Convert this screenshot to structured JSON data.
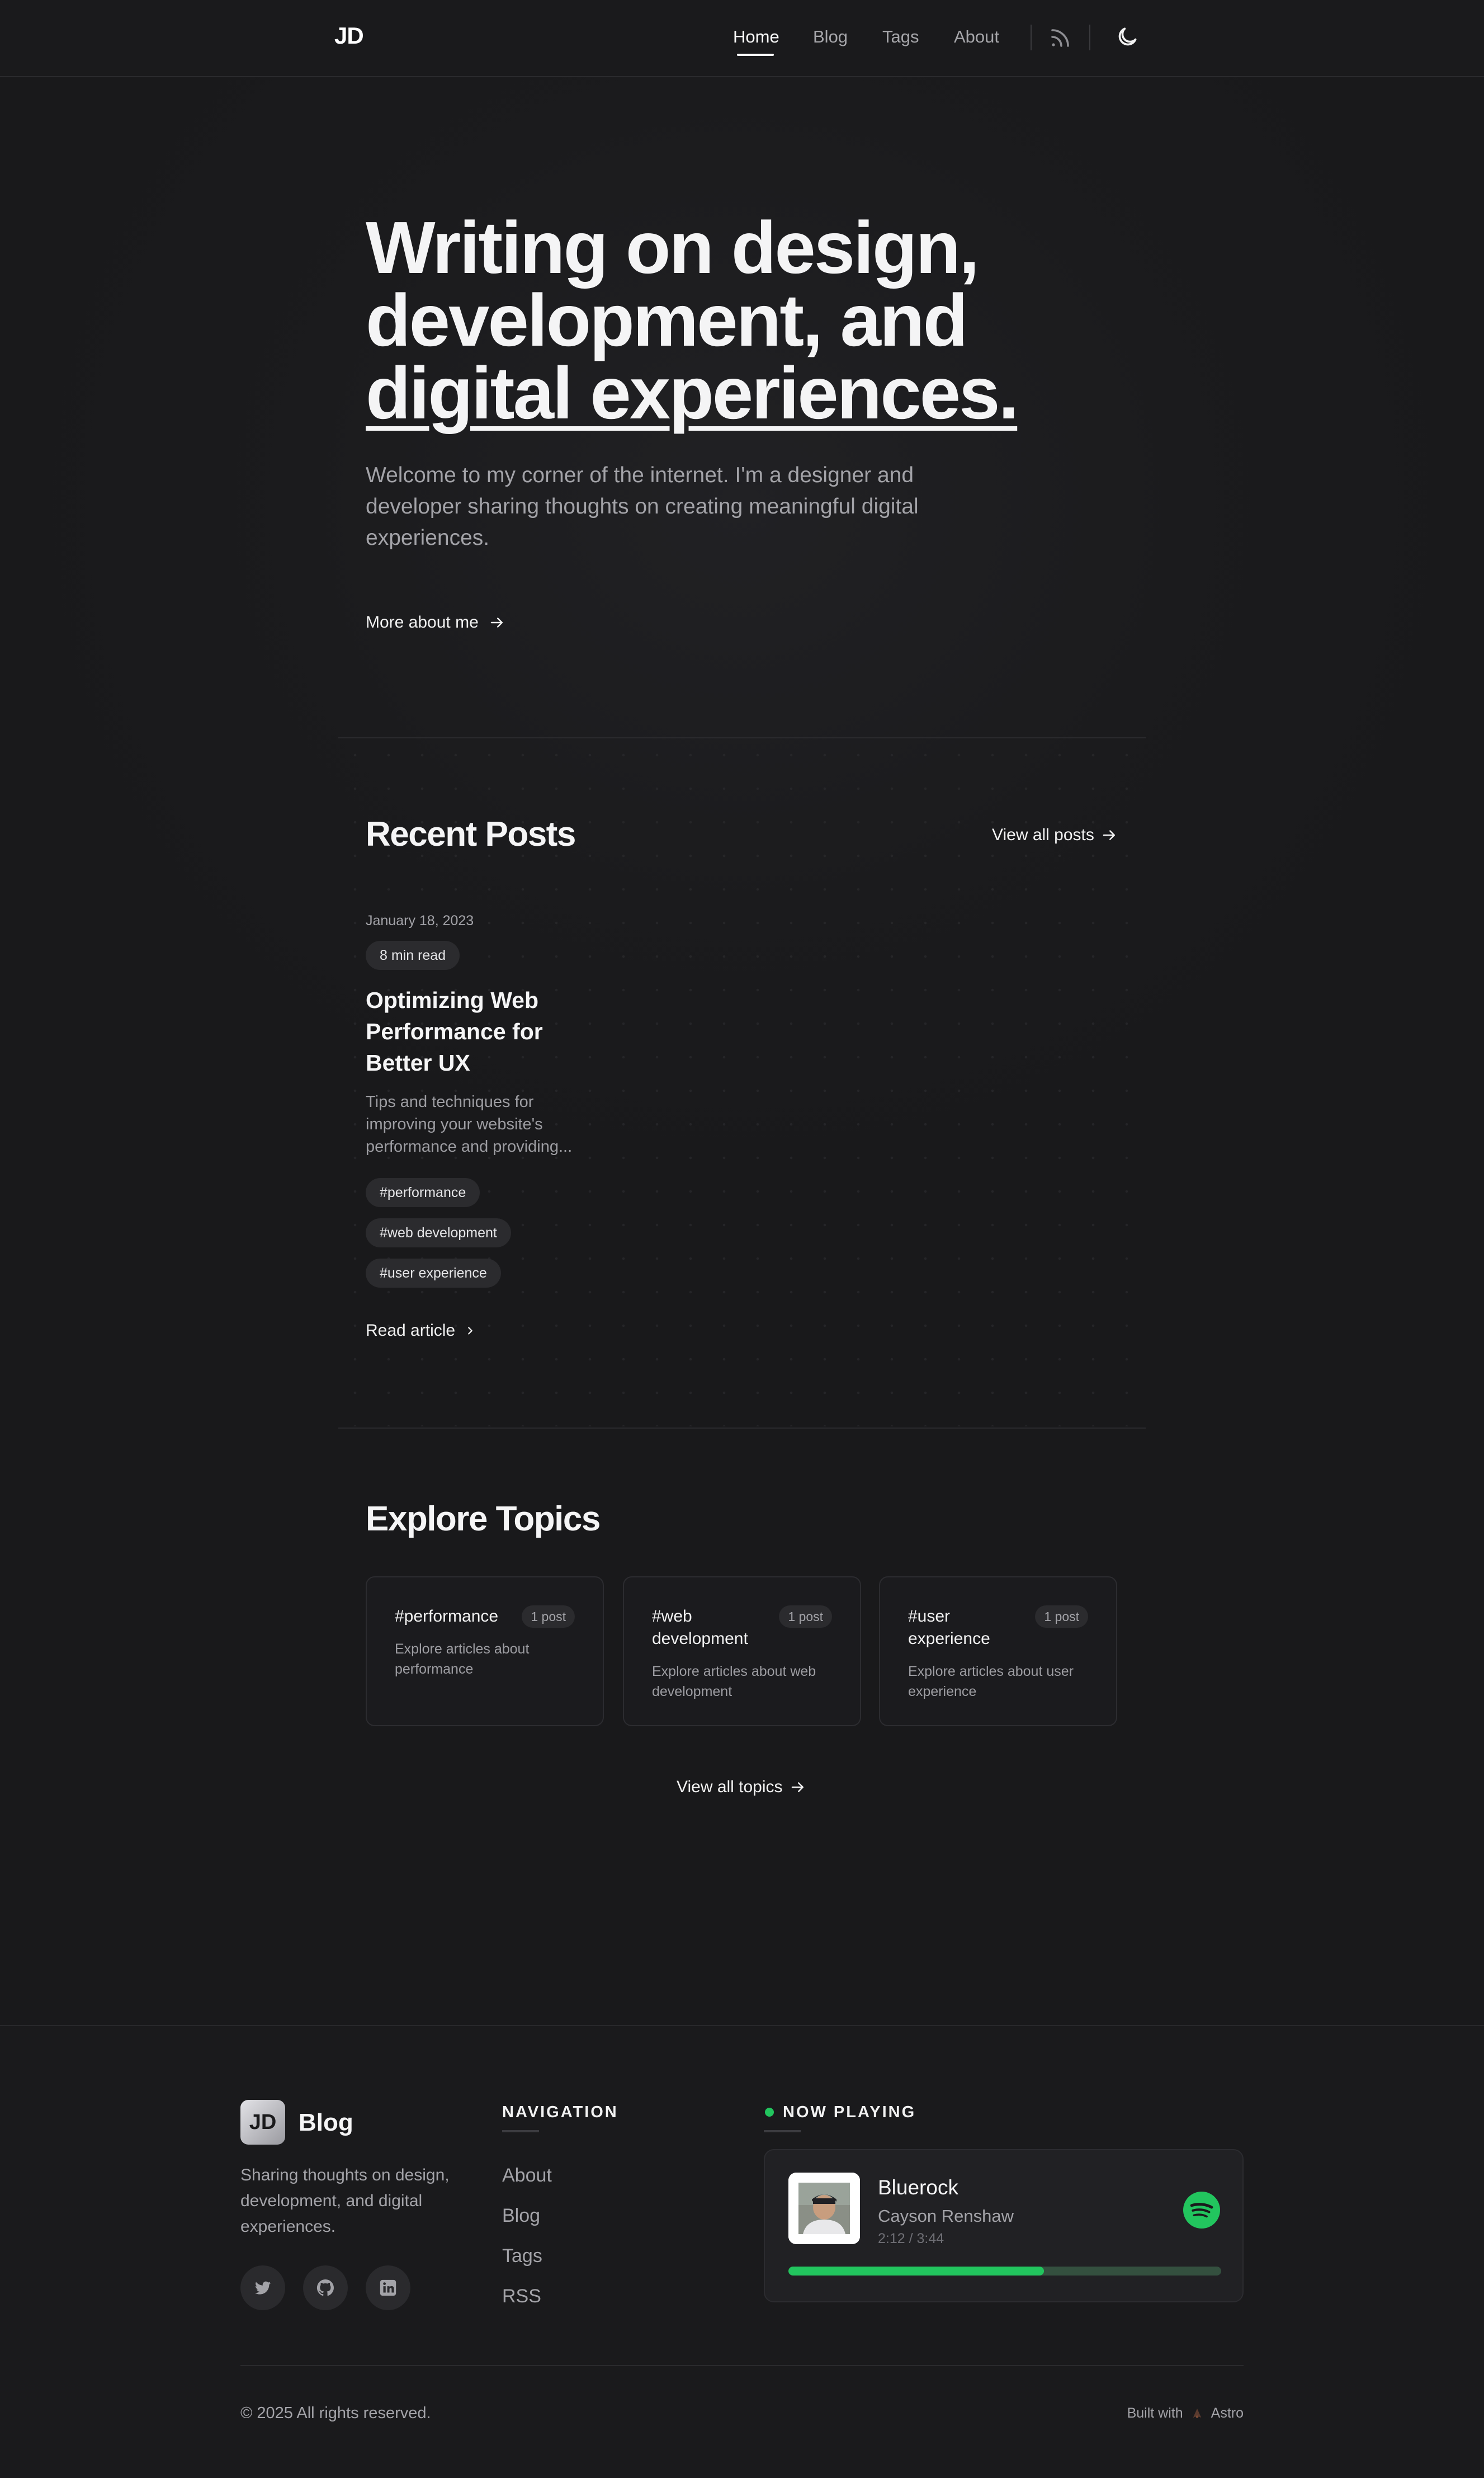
{
  "header": {
    "logo": "JD",
    "nav": [
      "Home",
      "Blog",
      "Tags",
      "About"
    ],
    "active_nav": "Home",
    "icons": [
      "rss-icon",
      "moon-icon"
    ]
  },
  "hero": {
    "title_line1": "Writing on design,",
    "title_line2": "development, and",
    "title_line3": "digital experiences.",
    "description": "Welcome to my corner of the internet. I'm a designer and developer sharing thoughts on creating meaningful digital experiences.",
    "cta": "More about me"
  },
  "recent_posts": {
    "heading": "Recent Posts",
    "view_all": "View all posts",
    "posts": [
      {
        "date": "January 18, 2023",
        "read_time": "8 min read",
        "title": "Optimizing Web Performance for Better UX",
        "excerpt": "Tips and techniques for improving your website's performance and providing...",
        "tags": [
          "#performance",
          "#web development",
          "#user experience"
        ],
        "cta": "Read article"
      }
    ]
  },
  "topics": {
    "heading": "Explore Topics",
    "items": [
      {
        "name": "#performance",
        "count": "1 post",
        "description": "Explore articles about performance"
      },
      {
        "name": "#web development",
        "count": "1 post",
        "description": "Explore articles about web development"
      },
      {
        "name": "#user experience",
        "count": "1 post",
        "description": "Explore articles about user experience"
      }
    ],
    "view_all": "View all topics"
  },
  "footer": {
    "logo": "JD",
    "brand": "Blog",
    "tagline": "Sharing thoughts on design, development, and digital experiences.",
    "socials": [
      "twitter-icon",
      "github-icon",
      "linkedin-icon"
    ],
    "nav_heading": "NAVIGATION",
    "nav_links": [
      "About",
      "Blog",
      "Tags",
      "RSS"
    ],
    "now_playing": {
      "heading": "NOW PLAYING",
      "track": "Bluerock",
      "artist": "Cayson Renshaw",
      "time": "2:12 / 3:44",
      "progress": 0.59,
      "status_color": "#22c55e"
    },
    "copyright": "© 2025 All rights reserved.",
    "built_with": "Built with",
    "framework": "Astro"
  },
  "colors": {
    "background": "#1a1a1c",
    "text": "#f2f2f2",
    "muted": "#a3a3a8",
    "accent": "#22c55e"
  }
}
